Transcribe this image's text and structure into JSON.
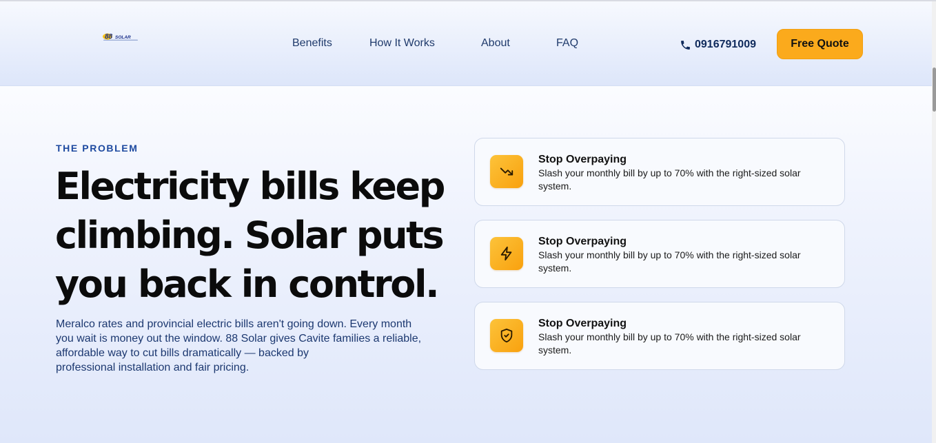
{
  "brand": {
    "logo_text": "88SOLAR",
    "colors": {
      "accent": "#fbaa1c",
      "navy": "#1f3a6b",
      "eyebrow": "#1e4aa0"
    }
  },
  "nav": {
    "items": [
      {
        "label": "Benefits"
      },
      {
        "label": "How It Works"
      },
      {
        "label": "About"
      },
      {
        "label": "FAQ"
      }
    ]
  },
  "contact": {
    "phone_icon": "phone-icon",
    "phone": "0916791009"
  },
  "cta": {
    "label": "Free Quote"
  },
  "hero": {
    "eyebrow": "THE PROBLEM",
    "headline_lines": [
      "Electricity bills keep",
      "climbing. Solar puts",
      "you back in control."
    ],
    "description_lines": [
      "Meralco rates and provincial electric bills aren't going down. Every month",
      "you wait is money out the window. 88 Solar gives Cavite families a reliable,",
      "affordable way to cut bills dramatically — backed by",
      "professional installation and fair pricing."
    ]
  },
  "features": [
    {
      "icon": "trending-down-icon",
      "title": "Stop Overpaying",
      "description": "Slash your monthly bill by up to 70% with the right-sized solar system."
    },
    {
      "icon": "lightning-bolt-icon",
      "title": "Stop Overpaying",
      "description": "Slash your monthly bill by up to 70% with the right-sized solar system."
    },
    {
      "icon": "shield-check-icon",
      "title": "Stop Overpaying",
      "description": "Slash your monthly bill by up to 70% with the right-sized solar system."
    }
  ]
}
